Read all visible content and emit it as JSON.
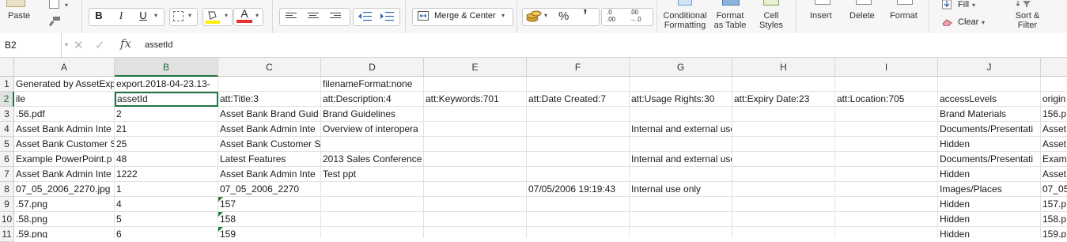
{
  "ribbon": {
    "paste_label": "Paste",
    "bold": "B",
    "italic": "I",
    "underline": "U",
    "font_color_glyph": "A",
    "merge_center_label": "Merge & Center",
    "percent_glyph": "%",
    "comma_glyph": "ʼ",
    "increase_decimal": ".0\n.00",
    "decrease_decimal": ".00\n→.0",
    "conditional_formatting": [
      "Conditional",
      "Formatting"
    ],
    "format_as_table": [
      "Format",
      "as Table"
    ],
    "cell_styles": [
      "Cell",
      "Styles"
    ],
    "insert_label": "Insert",
    "delete_label": "Delete",
    "format_label": "Format",
    "fill_label": "Fill",
    "clear_label": "Clear",
    "sort_filter": [
      "Sort &",
      "Filter"
    ],
    "fill_highlight_color": "#ffee00",
    "font_color": "#e5312f",
    "accent": "#217346"
  },
  "formula_bar": {
    "name_box": "B2",
    "cancel_icon": "✕",
    "enter_icon": "✓",
    "fx": "fx",
    "value": "assetId"
  },
  "columns": [
    "A",
    "B",
    "C",
    "D",
    "E",
    "F",
    "G",
    "H",
    "I",
    "J",
    ""
  ],
  "rows": [
    {
      "num": "1",
      "cells": [
        "Generated by AssetExp",
        "export.2018-04-23.13-",
        "",
        "filenameFormat:none",
        "",
        "",
        "",
        "",
        "",
        "",
        ""
      ]
    },
    {
      "num": "2",
      "cells": [
        "ile",
        "assetId",
        "att:Title:3",
        "att:Description:4",
        "att:Keywords:701",
        "att:Date Created:7",
        "att:Usage Rights:30",
        "att:Expiry Date:23",
        "att:Location:705",
        "accessLevels",
        "origin"
      ]
    },
    {
      "num": "3",
      "cells": [
        ".56.pdf",
        "2",
        "Asset Bank Brand Guid",
        "Brand Guidelines",
        "",
        "",
        "",
        "",
        "",
        "Brand Materials",
        "156.p"
      ]
    },
    {
      "num": "4",
      "cells": [
        "Asset Bank Admin Inte",
        "21",
        "Asset Bank Admin Inte",
        "Overview of interopera",
        "",
        "",
        "Internal and external use approved",
        "",
        "",
        "Documents/Presentati",
        "Asset"
      ]
    },
    {
      "num": "5",
      "cells": [
        "Asset Bank Customer S",
        "25",
        "Asset Bank Customer S",
        "",
        "",
        "",
        "",
        "",
        "",
        "Hidden",
        "Asset"
      ]
    },
    {
      "num": "6",
      "cells": [
        "Example PowerPoint.p",
        "48",
        "Latest Features",
        "2013 Sales Conference",
        "",
        "",
        "Internal and external use approved",
        "",
        "",
        "Documents/Presentati",
        "Exam"
      ]
    },
    {
      "num": "7",
      "cells": [
        "Asset Bank Admin Inte",
        "1222",
        "Asset Bank Admin Inte",
        "Test ppt",
        "",
        "",
        "",
        "",
        "",
        "Hidden",
        "Asset"
      ]
    },
    {
      "num": "8",
      "cells": [
        "07_05_2006_2270.jpg",
        "1",
        "07_05_2006_2270",
        "",
        "",
        "07/05/2006 19:19:43",
        "Internal use only",
        "",
        "",
        "Images/Places",
        "07_05"
      ]
    },
    {
      "num": "9",
      "cells": [
        ".57.png",
        "4",
        "157",
        "",
        "",
        "",
        "",
        "",
        "",
        "Hidden",
        "157.p"
      ]
    },
    {
      "num": "10",
      "cells": [
        ".58.png",
        "5",
        "158",
        "",
        "",
        "",
        "",
        "",
        "",
        "Hidden",
        "158.p"
      ]
    },
    {
      "num": "11",
      "cells": [
        ".59.png",
        "6",
        "159",
        "",
        "",
        "",
        "",
        "",
        "",
        "Hidden",
        "159.p"
      ]
    }
  ]
}
